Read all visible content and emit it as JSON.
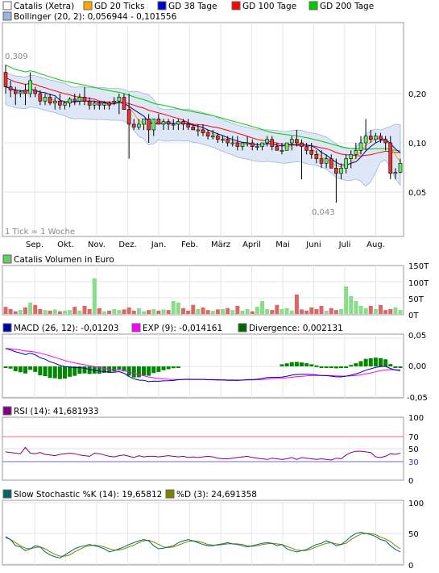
{
  "price_panel": {
    "legend": [
      {
        "label": "Catalis (Xetra)",
        "color": "#ffffff"
      },
      {
        "label": "GD 20 Ticks",
        "color": "#ffa500"
      },
      {
        "label": "GD 38 Tage",
        "color": "#0000cc"
      },
      {
        "label": "GD 100 Tage",
        "color": "#ff0000"
      },
      {
        "label": "GD 200 Tage",
        "color": "#00cc00"
      }
    ],
    "bollinger_label": "Bollinger (20, 2): 0,056944 - 0,101556",
    "bollinger_color": "#9bb5e0",
    "y_ticks": [
      "0,20",
      "0,10",
      "0,05"
    ],
    "high_label": "0,309",
    "low_label": "0,043",
    "tick_note": "1 Tick = 1 Woche",
    "x_labels": [
      "Sep.",
      "Okt.",
      "Nov.",
      "Dez.",
      "Jan.",
      "Feb.",
      "März",
      "April",
      "Mai",
      "Juni",
      "Juli",
      "Aug."
    ]
  },
  "volume_panel": {
    "label": "Catalis Volumen in Euro",
    "color": "#66cc66",
    "y_ticks": [
      "150T",
      "100T",
      "50T",
      "0T"
    ]
  },
  "macd_panel": {
    "macd_label": "MACD (26, 12): -0,01203",
    "macd_color": "#0000aa",
    "exp_label": "EXP (9): -0,014161",
    "exp_color": "#ff00ff",
    "div_label": "Divergence: 0,002131",
    "div_color": "#006600",
    "y_ticks": [
      "0,05",
      "0,00",
      "-0,05"
    ]
  },
  "rsi_panel": {
    "label": "RSI (14): 41,681933",
    "color": "#800080",
    "y_ticks": [
      "100",
      "70",
      "50",
      "30",
      "0"
    ]
  },
  "stoch_panel": {
    "k_label": "Slow Stochastic %K (14): 19,65812",
    "k_color": "#006666",
    "d_label": "%D (3): 24,691358",
    "d_color": "#808000",
    "y_ticks": [
      "100",
      "50",
      "0"
    ]
  },
  "chart_data": {
    "type": "line",
    "title": "Catalis (Xetra)",
    "x": [
      "Sep.",
      "Okt.",
      "Nov.",
      "Dez.",
      "Jan.",
      "Feb.",
      "März",
      "April",
      "Mai",
      "Juni",
      "Juli",
      "Aug."
    ],
    "y_scale": "log",
    "ylim": [
      0.03,
      0.35
    ],
    "candles": [
      [
        0.27,
        0.3,
        0.2,
        0.22
      ],
      [
        0.22,
        0.24,
        0.19,
        0.21
      ],
      [
        0.21,
        0.22,
        0.17,
        0.2
      ],
      [
        0.2,
        0.21,
        0.19,
        0.205
      ],
      [
        0.21,
        0.23,
        0.17,
        0.2
      ],
      [
        0.2,
        0.27,
        0.19,
        0.24
      ],
      [
        0.21,
        0.22,
        0.19,
        0.2
      ],
      [
        0.2,
        0.21,
        0.17,
        0.18
      ],
      [
        0.18,
        0.2,
        0.17,
        0.19
      ],
      [
        0.19,
        0.2,
        0.17,
        0.175
      ],
      [
        0.175,
        0.19,
        0.16,
        0.18
      ],
      [
        0.18,
        0.2,
        0.16,
        0.17
      ],
      [
        0.17,
        0.18,
        0.16,
        0.175
      ],
      [
        0.175,
        0.19,
        0.165,
        0.185
      ],
      [
        0.185,
        0.2,
        0.17,
        0.18
      ],
      [
        0.18,
        0.2,
        0.17,
        0.19
      ],
      [
        0.19,
        0.22,
        0.17,
        0.18
      ],
      [
        0.18,
        0.19,
        0.16,
        0.17
      ],
      [
        0.17,
        0.18,
        0.16,
        0.175
      ],
      [
        0.175,
        0.18,
        0.16,
        0.17
      ],
      [
        0.17,
        0.18,
        0.16,
        0.175
      ],
      [
        0.175,
        0.18,
        0.16,
        0.17
      ],
      [
        0.18,
        0.19,
        0.17,
        0.18
      ],
      [
        0.18,
        0.2,
        0.15,
        0.19
      ],
      [
        0.19,
        0.2,
        0.17,
        0.16
      ],
      [
        0.16,
        0.2,
        0.08,
        0.13
      ],
      [
        0.13,
        0.14,
        0.12,
        0.125
      ],
      [
        0.125,
        0.14,
        0.12,
        0.13
      ],
      [
        0.13,
        0.14,
        0.12,
        0.14
      ],
      [
        0.14,
        0.15,
        0.1,
        0.12
      ],
      [
        0.12,
        0.14,
        0.11,
        0.14
      ],
      [
        0.14,
        0.15,
        0.13,
        0.13
      ],
      [
        0.13,
        0.14,
        0.12,
        0.135
      ],
      [
        0.135,
        0.14,
        0.12,
        0.13
      ],
      [
        0.13,
        0.14,
        0.12,
        0.13
      ],
      [
        0.13,
        0.14,
        0.12,
        0.135
      ],
      [
        0.135,
        0.14,
        0.12,
        0.13
      ],
      [
        0.13,
        0.14,
        0.12,
        0.125
      ],
      [
        0.125,
        0.13,
        0.12,
        0.12
      ],
      [
        0.12,
        0.13,
        0.11,
        0.12
      ],
      [
        0.12,
        0.13,
        0.11,
        0.115
      ],
      [
        0.115,
        0.12,
        0.105,
        0.11
      ],
      [
        0.11,
        0.12,
        0.105,
        0.11
      ],
      [
        0.11,
        0.115,
        0.1,
        0.105
      ],
      [
        0.105,
        0.11,
        0.1,
        0.105
      ],
      [
        0.105,
        0.11,
        0.095,
        0.1
      ],
      [
        0.1,
        0.11,
        0.095,
        0.1
      ],
      [
        0.1,
        0.11,
        0.09,
        0.095
      ],
      [
        0.095,
        0.1,
        0.09,
        0.1
      ],
      [
        0.1,
        0.11,
        0.095,
        0.1
      ],
      [
        0.1,
        0.105,
        0.09,
        0.095
      ],
      [
        0.095,
        0.1,
        0.09,
        0.095
      ],
      [
        0.095,
        0.1,
        0.09,
        0.1
      ],
      [
        0.1,
        0.11,
        0.095,
        0.105
      ],
      [
        0.105,
        0.11,
        0.09,
        0.095
      ],
      [
        0.095,
        0.1,
        0.09,
        0.09
      ],
      [
        0.09,
        0.1,
        0.085,
        0.09
      ],
      [
        0.09,
        0.1,
        0.09,
        0.1
      ],
      [
        0.1,
        0.11,
        0.09,
        0.105
      ],
      [
        0.105,
        0.12,
        0.095,
        0.1
      ],
      [
        0.1,
        0.105,
        0.06,
        0.095
      ],
      [
        0.095,
        0.1,
        0.085,
        0.09
      ],
      [
        0.09,
        0.1,
        0.08,
        0.085
      ],
      [
        0.085,
        0.09,
        0.075,
        0.08
      ],
      [
        0.08,
        0.09,
        0.07,
        0.075
      ],
      [
        0.075,
        0.085,
        0.07,
        0.08
      ],
      [
        0.08,
        0.085,
        0.07,
        0.07
      ],
      [
        0.07,
        0.08,
        0.043,
        0.065
      ],
      [
        0.065,
        0.075,
        0.06,
        0.07
      ],
      [
        0.07,
        0.085,
        0.065,
        0.08
      ],
      [
        0.08,
        0.09,
        0.07,
        0.085
      ],
      [
        0.085,
        0.1,
        0.08,
        0.09
      ],
      [
        0.09,
        0.11,
        0.085,
        0.1
      ],
      [
        0.1,
        0.14,
        0.09,
        0.11
      ],
      [
        0.11,
        0.12,
        0.1,
        0.105
      ],
      [
        0.105,
        0.115,
        0.1,
        0.11
      ],
      [
        0.11,
        0.115,
        0.1,
        0.105
      ],
      [
        0.105,
        0.11,
        0.09,
        0.1
      ],
      [
        0.1,
        0.11,
        0.06,
        0.065
      ],
      [
        0.065,
        0.07,
        0.06,
        0.066
      ],
      [
        0.066,
        0.08,
        0.065,
        0.075
      ]
    ],
    "volume": [
      22,
      15,
      8,
      12,
      20,
      35,
      28,
      15,
      12,
      10,
      14,
      8,
      10,
      12,
      22,
      10,
      25,
      15,
      110,
      18,
      8,
      10,
      15,
      12,
      14,
      20,
      10,
      18,
      8,
      12,
      15,
      10,
      14,
      12,
      40,
      35,
      18,
      10,
      28,
      15,
      20,
      12,
      10,
      14,
      15,
      18,
      12,
      25,
      10,
      15,
      8,
      22,
      40,
      15,
      12,
      28,
      15,
      18,
      10,
      60,
      14,
      10,
      20,
      15,
      25,
      10,
      18,
      12,
      15,
      85,
      55,
      40,
      25,
      18,
      25,
      15,
      28,
      12,
      15,
      20,
      12
    ],
    "rsi_k": [
      45,
      44,
      43,
      42,
      52,
      43,
      42,
      44,
      41,
      40,
      39,
      41,
      42,
      43,
      42,
      40,
      39,
      38,
      43,
      42,
      40,
      38,
      37,
      39,
      40,
      38,
      36,
      39,
      37,
      38,
      38,
      37,
      38,
      39,
      38,
      37,
      38,
      36,
      37,
      36,
      37,
      38,
      37,
      35,
      34,
      34,
      35,
      36,
      37,
      38,
      36,
      35,
      34,
      33,
      35,
      34,
      33,
      34,
      36,
      33,
      36,
      35,
      34,
      33,
      34,
      33,
      32,
      35,
      34,
      40,
      44,
      46,
      46,
      45,
      44,
      37,
      36,
      38,
      42,
      41,
      43
    ],
    "stoch_k": [
      45,
      40,
      30,
      28,
      22,
      25,
      30,
      28,
      20,
      15,
      12,
      10,
      15,
      20,
      25,
      28,
      30,
      32,
      30,
      28,
      25,
      20,
      22,
      25,
      28,
      32,
      35,
      38,
      40,
      38,
      30,
      25,
      26,
      28,
      30,
      35,
      38,
      40,
      38,
      35,
      32,
      30,
      30,
      32,
      33,
      35,
      33,
      32,
      30,
      28,
      30,
      32,
      34,
      35,
      34,
      30,
      32,
      25,
      22,
      20,
      22,
      24,
      28,
      32,
      34,
      38,
      35,
      30,
      32,
      38,
      45,
      50,
      52,
      50,
      48,
      45,
      40,
      38,
      30,
      24,
      20
    ],
    "stoch_d": [
      43,
      40,
      35,
      30,
      26,
      25,
      27,
      28,
      25,
      20,
      16,
      13,
      13,
      15,
      20,
      24,
      28,
      30,
      31,
      30,
      28,
      25,
      23,
      23,
      25,
      28,
      31,
      35,
      38,
      39,
      36,
      32,
      28,
      27,
      28,
      31,
      34,
      37,
      38,
      37,
      35,
      32,
      31,
      31,
      32,
      33,
      33,
      33,
      32,
      30,
      29,
      30,
      32,
      33,
      34,
      33,
      32,
      29,
      26,
      23,
      22,
      22,
      25,
      28,
      31,
      34,
      35,
      33,
      32,
      34,
      40,
      45,
      49,
      50,
      50,
      48,
      44,
      41,
      37,
      30,
      25
    ]
  }
}
